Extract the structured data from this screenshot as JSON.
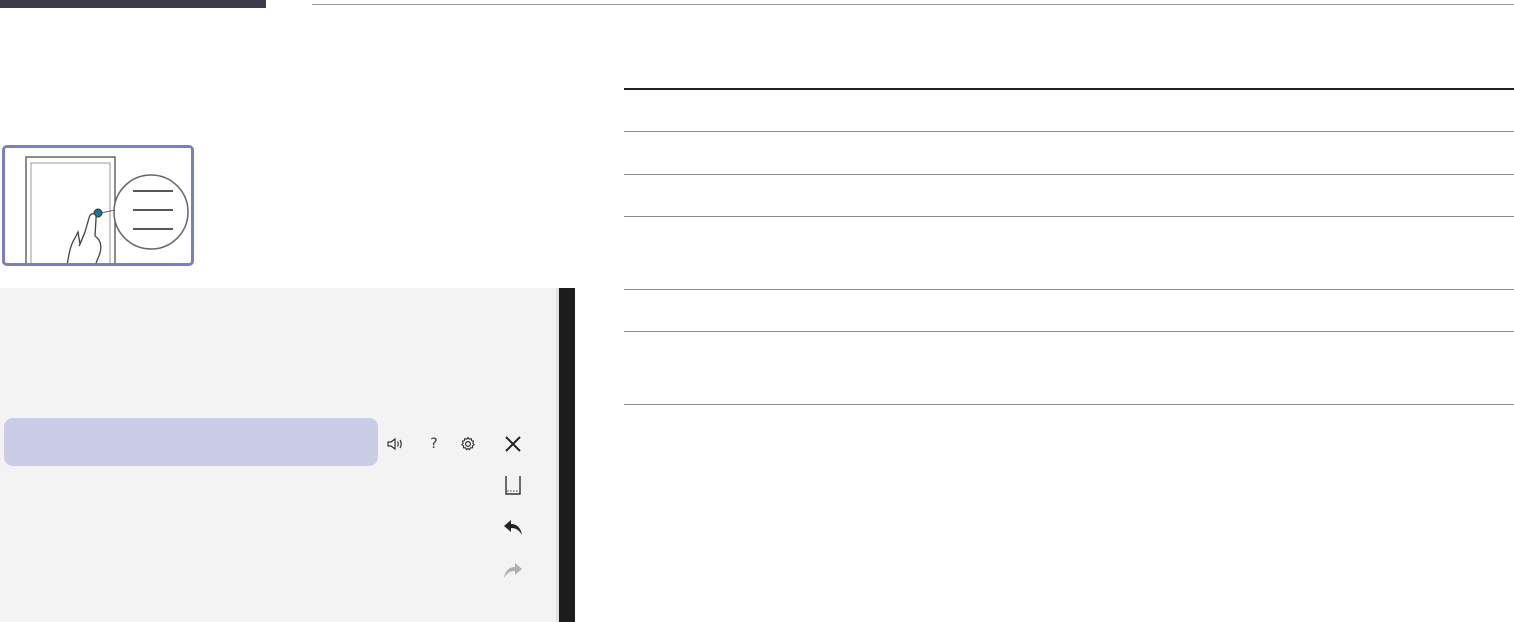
{
  "header": {
    "accent_color": "#3a3a4a"
  },
  "illustration": {
    "border_color": "#7b7fc2"
  },
  "table": {
    "rows": [
      "",
      "",
      "",
      "",
      "",
      "",
      ""
    ]
  },
  "panel": {
    "background_color": "#f3f3f3",
    "highlight_color": "#cbcde6",
    "toolbar_icons": [
      "speaker-icon",
      "help-icon",
      "gear-icon",
      "close-icon"
    ],
    "help_glyph": "?",
    "side_icons": [
      "bookmark-icon",
      "undo-icon",
      "redo-icon"
    ]
  }
}
